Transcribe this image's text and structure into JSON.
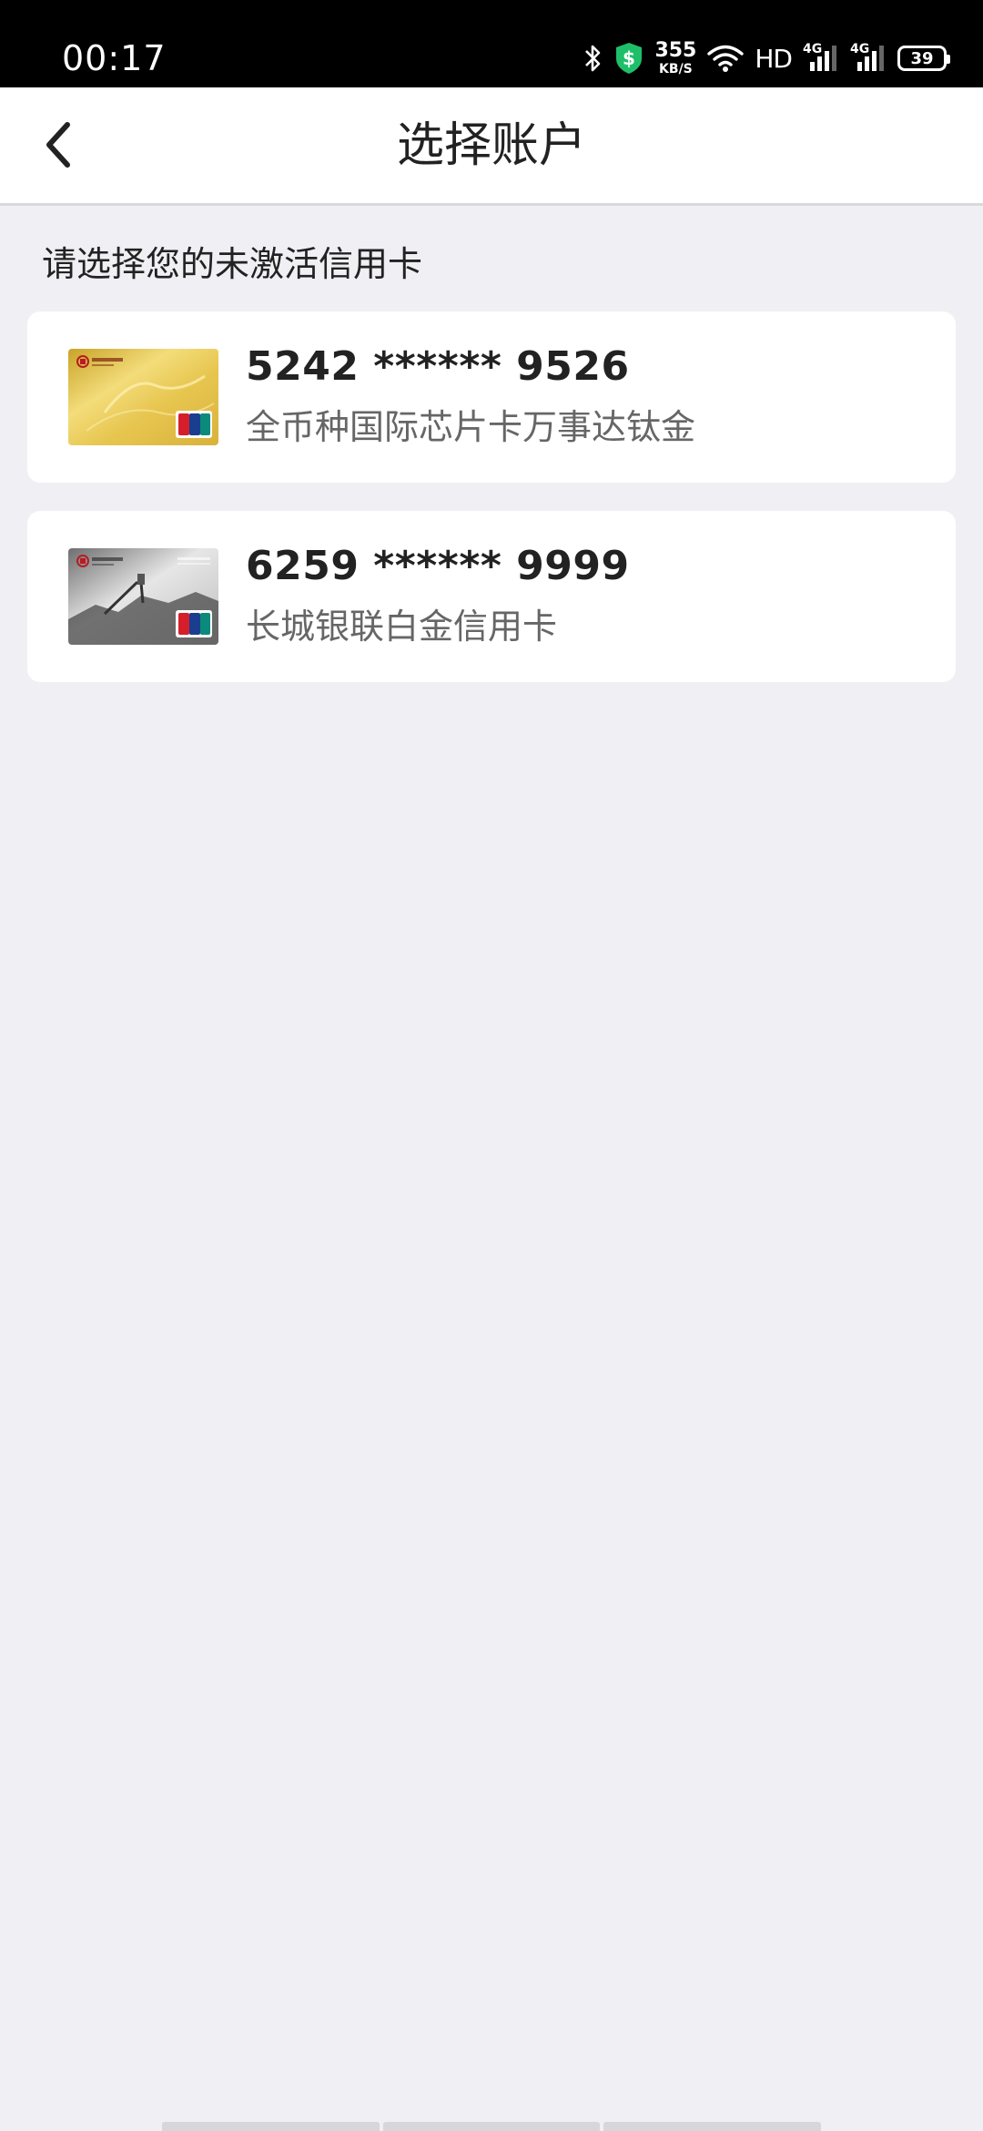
{
  "status_bar": {
    "time": "00:17",
    "net_speed": "355",
    "net_speed_unit": "KB/S",
    "hd_label": "HD",
    "signal_label_1": "4G",
    "signal_label_2": "4G",
    "battery_level": "39",
    "icons": [
      "bluetooth-icon",
      "shield-icon",
      "wifi-icon",
      "signal-icon",
      "battery-icon"
    ]
  },
  "header": {
    "title": "选择账户",
    "back_icon": "chevron-left-icon"
  },
  "prompt": "请选择您的未激活信用卡",
  "cards": [
    {
      "number": "5242 ****** 9526",
      "name": "全币种国际芯片卡万事达钛金",
      "thumb_color": "#e3c34a"
    },
    {
      "number": "6259 ****** 9999",
      "name": "长城银联白金信用卡",
      "thumb_color": "#a9a9a9"
    }
  ],
  "colors": {
    "background": "#efeff4",
    "card_background": "#ffffff",
    "primary_text": "#222222",
    "secondary_text": "#666666",
    "boc_red": "#b81c22"
  }
}
